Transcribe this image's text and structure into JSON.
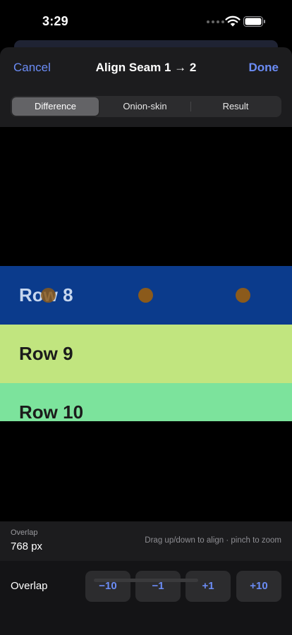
{
  "status": {
    "time": "3:29"
  },
  "nav": {
    "cancel": "Cancel",
    "title": "Align Seam 1 → 2",
    "done": "Done"
  },
  "segments": {
    "items": [
      "Difference",
      "Onion-skin",
      "Result"
    ],
    "selected": "Difference"
  },
  "rows": [
    {
      "label": "Row 8",
      "color": "#0b3b8c",
      "text_color": "#c6d6ee",
      "markers": 3
    },
    {
      "label": "Row 9",
      "color": "#c1e57f",
      "text_color": "#1b1b1b"
    },
    {
      "label": "Row 10",
      "color": "#7ce39c",
      "text_color": "#1b1b1b"
    }
  ],
  "marker_color": "#8b5a1b",
  "overlap_info": {
    "title": "Overlap",
    "value": "768 px",
    "hint": "Drag up/down to align · pinch to zoom"
  },
  "controls": {
    "label": "Overlap",
    "buttons": [
      "−10",
      "−1",
      "+1",
      "+10"
    ]
  },
  "accent_color": "#6b8cf5"
}
